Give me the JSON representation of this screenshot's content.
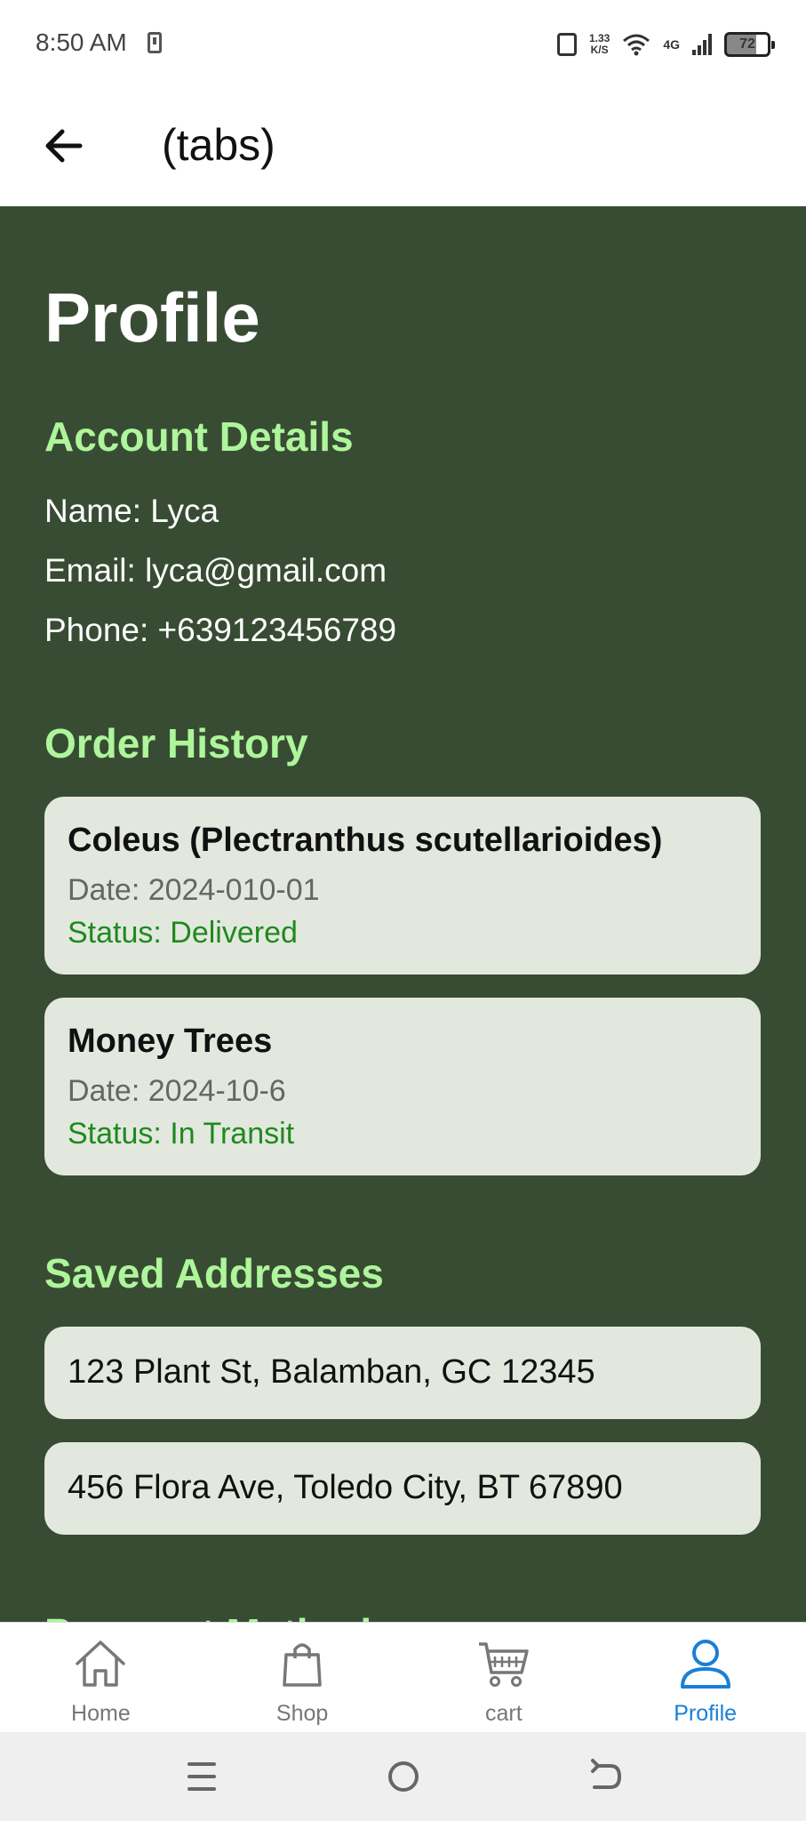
{
  "status_bar": {
    "time": "8:50 AM",
    "speed_value": "1.33",
    "speed_unit": "K/S",
    "network": "4G",
    "battery": "72"
  },
  "header": {
    "title": "(tabs)",
    "back_icon": "arrow-left-icon"
  },
  "profile": {
    "title": "Profile",
    "account": {
      "heading": "Account Details",
      "name": "Name: Lyca",
      "email": "Email: lyca@gmail.com",
      "phone": "Phone: +639123456789"
    },
    "orders": {
      "heading": "Order History",
      "items": [
        {
          "name": "Coleus (Plectranthus scutellarioides)",
          "date": "Date: 2024-010-01",
          "status": "Status: Delivered"
        },
        {
          "name": "Money Trees",
          "date": "Date: 2024-10-6",
          "status": "Status: In Transit"
        }
      ]
    },
    "addresses": {
      "heading": "Saved Addresses",
      "items": [
        "123 Plant St, Balamban, GC 12345",
        "456 Flora Ave, Toledo City, BT 67890"
      ]
    },
    "payment_heading": "Payment Methods"
  },
  "bottom_nav": {
    "items": [
      {
        "label": "Home",
        "icon": "home-icon"
      },
      {
        "label": "Shop",
        "icon": "shopping-bag-icon"
      },
      {
        "label": "cart",
        "icon": "cart-icon"
      },
      {
        "label": "Profile",
        "icon": "person-icon",
        "active": true
      }
    ]
  },
  "system_nav": {
    "icons": [
      "menu-icon",
      "home-circle-icon",
      "back-icon"
    ]
  },
  "colors": {
    "background": "#384c33",
    "heading": "#aef59b",
    "card": "#e3e8de",
    "status_green": "#1e8a1e",
    "active_tab": "#1a7fd6"
  }
}
